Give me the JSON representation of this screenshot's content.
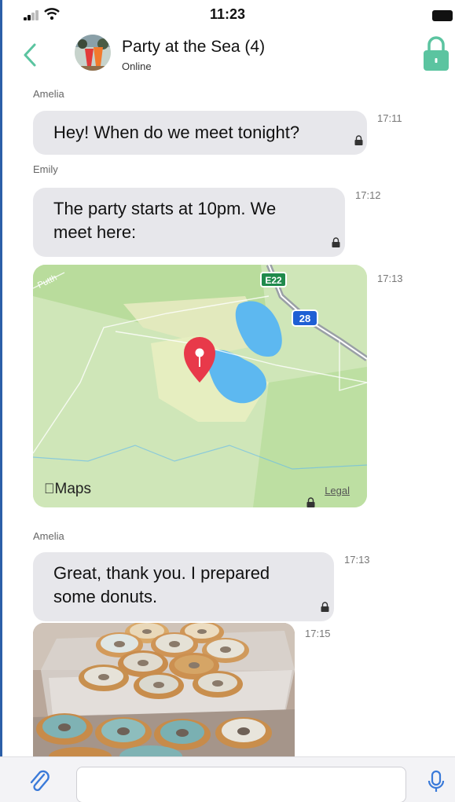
{
  "status_bar": {
    "time": "11:23"
  },
  "header": {
    "title": "Party at the Sea (4)",
    "status": "Online"
  },
  "messages": [
    {
      "sender": "Amelia",
      "text": "Hey! When do we meet tonight?",
      "time": "17:11"
    },
    {
      "sender": "Emily",
      "lines": [
        "The party starts at 10pm. We",
        "meet here:"
      ],
      "time": "17:12"
    },
    {
      "map": {
        "brand": "Maps",
        "legal": "Legal",
        "road_label": "Putth",
        "shield_e": "E22",
        "shield_route": "28"
      },
      "time": "17:13"
    },
    {
      "sender": "Amelia",
      "lines": [
        "Great, thank you. I prepared",
        "some donuts."
      ],
      "time": "17:13"
    },
    {
      "photo": "donuts-photo",
      "time": "17:15"
    }
  ],
  "composer": {
    "placeholder": ""
  },
  "icons": [
    "back-icon",
    "lock-icon",
    "attach-icon",
    "mic-icon",
    "map-pin-icon"
  ],
  "colors": {
    "accent": "#5bc4a0",
    "bubble": "#e7e7eb",
    "map_land": "#cfe6b8",
    "map_water": "#5db8f0",
    "pin": "#e8394a",
    "icon_blue": "#3a7ad9"
  }
}
